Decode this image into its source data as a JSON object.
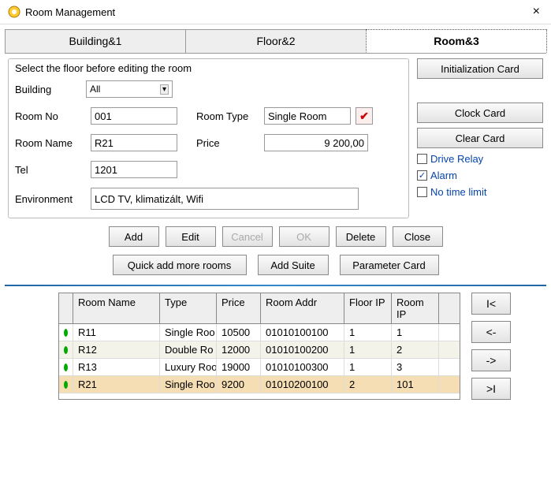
{
  "window": {
    "title": "Room Management",
    "close": "×"
  },
  "tabs": [
    {
      "label": "Building&1"
    },
    {
      "label": "Floor&2"
    },
    {
      "label": "Room&3",
      "active": true
    }
  ],
  "form": {
    "header": "Select the floor before editing the room",
    "building_label": "Building",
    "building_value": "All",
    "roomno_label": "Room No",
    "roomno_value": "001",
    "roomtype_label": "Room Type",
    "roomtype_value": "Single Room",
    "roomname_label": "Room Name",
    "roomname_value": "R21",
    "price_label": "Price",
    "price_value": "9 200,00",
    "tel_label": "Tel",
    "tel_value": "1201",
    "env_label": "Environment",
    "env_value": "LCD TV, klimatizált, Wifi"
  },
  "right": {
    "init_card": "Initialization Card",
    "clock_card": "Clock Card",
    "clear_card": "Clear Card",
    "drive_relay": "Drive Relay",
    "alarm": "Alarm",
    "no_time_limit": "No time limit",
    "alarm_checked": "✓"
  },
  "buttons": {
    "add": "Add",
    "edit": "Edit",
    "cancel": "Cancel",
    "ok": "OK",
    "delete": "Delete",
    "close": "Close",
    "quick_add": "Quick add more rooms",
    "add_suite": "Add Suite",
    "param_card": "Parameter Card"
  },
  "table": {
    "headers": {
      "name": "Room Name",
      "type": "Type",
      "price": "Price",
      "addr": "Room Addr",
      "fip": "Floor IP",
      "rip": "Room IP"
    },
    "rows": [
      {
        "name": "R11",
        "type": "Single Roo",
        "price": "10500",
        "addr": "01010100100",
        "fip": "1",
        "rip": "1"
      },
      {
        "name": "R12",
        "type": "Double Ro",
        "price": "12000",
        "addr": "01010100200",
        "fip": "1",
        "rip": "2"
      },
      {
        "name": "R13",
        "type": "Luxury Roo",
        "price": "19000",
        "addr": "01010100300",
        "fip": "1",
        "rip": "3"
      },
      {
        "name": "R21",
        "type": "Single Roo",
        "price": "9200",
        "addr": "01010200100",
        "fip": "2",
        "rip": "101",
        "selected": true
      }
    ]
  },
  "nav": {
    "first": "I<",
    "prev": "<-",
    "next": "->",
    "last": ">I"
  }
}
